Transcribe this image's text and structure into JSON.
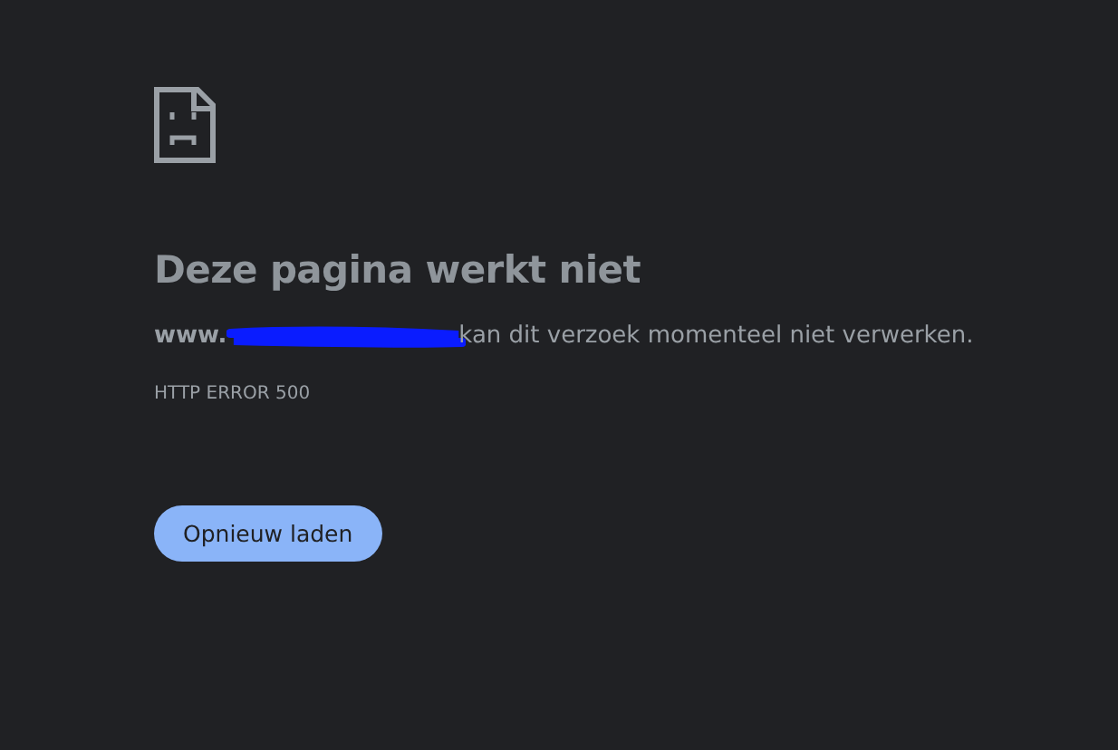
{
  "title": "Deze pagina werkt niet",
  "message": {
    "domain": "www.",
    "redacted": true,
    "text": "kan dit verzoek momenteel niet verwerken."
  },
  "error_code": "HTTP ERROR 500",
  "buttons": [
    "Opnieuw laden"
  ]
}
